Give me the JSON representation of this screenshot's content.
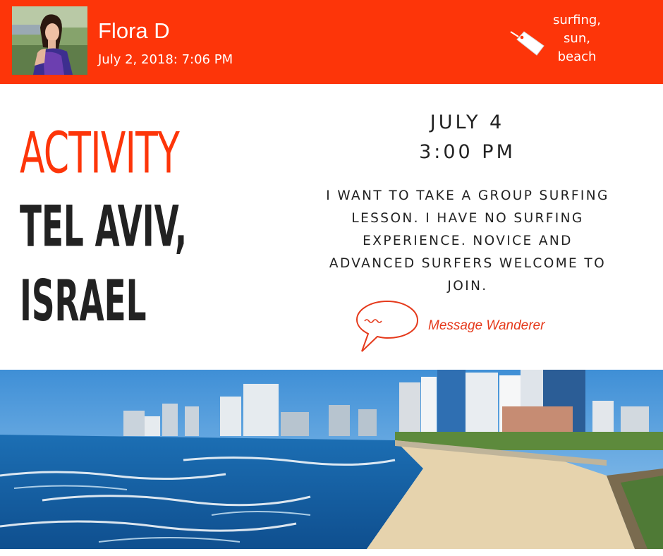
{
  "post": {
    "author": "Flora D",
    "timestamp": "July 2, 2018: 7:06 PM",
    "tags": [
      "surfing,",
      "sun,",
      "beach"
    ]
  },
  "event": {
    "category": "ACTIVITY",
    "location_lines": [
      "TEL AVIV,",
      "ISRAEL"
    ],
    "date": "JULY 4",
    "time": "3:00 PM",
    "description_lines": [
      "I WANT TO TAKE A GROUP SURFING",
      "LESSON. I HAVE NO SURFING",
      "EXPERIENCE. NOVICE AND",
      "ADVANCED SURFERS WELCOME TO",
      "JOIN."
    ]
  },
  "actions": {
    "message_label": "Message Wanderer"
  },
  "icons": {
    "tag": "tag-icon",
    "message": "speech-bubble-icon"
  },
  "colors": {
    "header_bg": "#fd3509",
    "accent": "#fd3509",
    "link": "#e53a1c",
    "text_dark": "#222222"
  }
}
